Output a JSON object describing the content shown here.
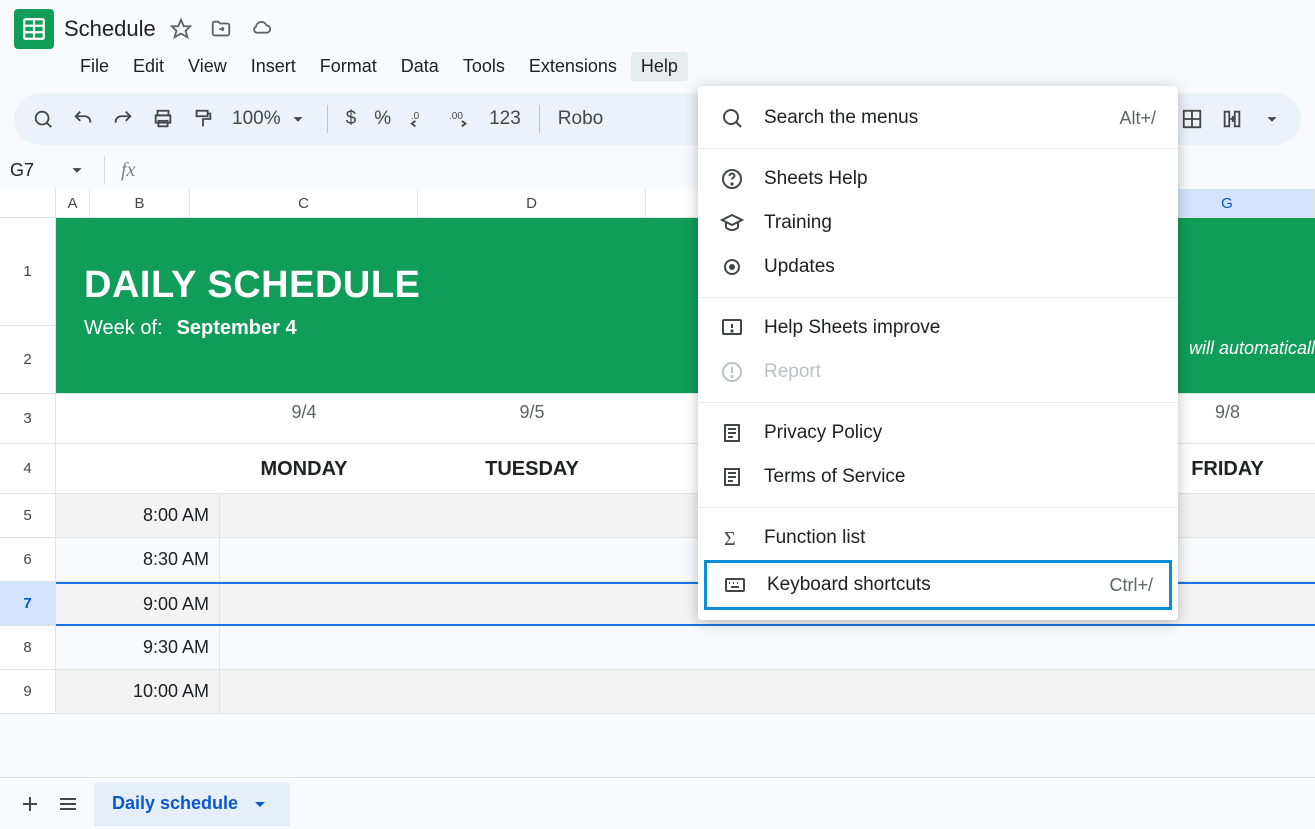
{
  "title": "Schedule",
  "menus": {
    "file": "File",
    "edit": "Edit",
    "view": "View",
    "insert": "Insert",
    "format": "Format",
    "data": "Data",
    "tools": "Tools",
    "extensions": "Extensions",
    "help": "Help"
  },
  "toolbar": {
    "zoom": "100%",
    "currency": "$",
    "percent": "%",
    "digits": "123",
    "font": "Robo"
  },
  "name_box": "G7",
  "banner": {
    "title": "DAILY SCHEDULE",
    "week_label": "Week of:",
    "week_value": "September 4",
    "note_partial": "will automaticall"
  },
  "columns": {
    "A": "A",
    "B": "B",
    "C": "C",
    "D": "D",
    "G": "G"
  },
  "days": [
    {
      "date": "9/4",
      "name": "MONDAY"
    },
    {
      "date": "9/5",
      "name": "TUESDAY"
    },
    {
      "date": "9/8",
      "name": "FRIDAY"
    }
  ],
  "rows": [
    "1",
    "2",
    "3",
    "4",
    "5",
    "6",
    "7",
    "8",
    "9"
  ],
  "times": [
    "8:00 AM",
    "8:30 AM",
    "9:00 AM",
    "9:30 AM",
    "10:00 AM"
  ],
  "sheet_tab": "Daily schedule",
  "help_menu": {
    "search": "Search the menus",
    "search_shortcut": "Alt+/",
    "sheets_help": "Sheets Help",
    "training": "Training",
    "updates": "Updates",
    "improve": "Help Sheets improve",
    "report": "Report",
    "privacy": "Privacy Policy",
    "terms": "Terms of Service",
    "functions": "Function list",
    "shortcuts": "Keyboard shortcuts",
    "shortcuts_key": "Ctrl+/"
  }
}
